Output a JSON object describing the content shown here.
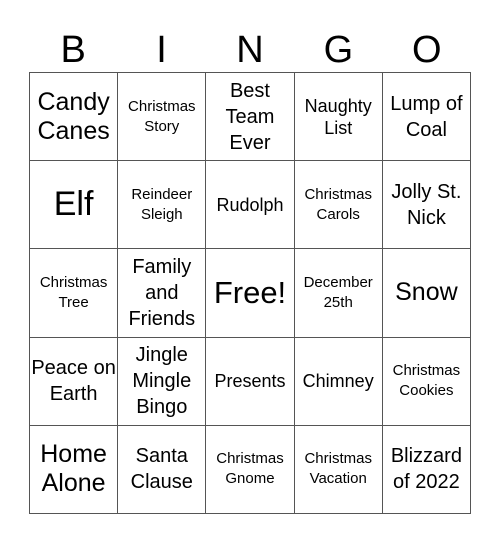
{
  "header": {
    "letters": [
      "B",
      "I",
      "N",
      "G",
      "O"
    ]
  },
  "grid": {
    "rows": [
      [
        {
          "text": "Candy Canes",
          "size": "s-l"
        },
        {
          "text": "Christmas Story",
          "size": "s-s"
        },
        {
          "text": "Best Team Ever",
          "size": "s-m"
        },
        {
          "text": "Naughty List",
          "size": "s-ms"
        },
        {
          "text": "Lump of Coal",
          "size": "s-m"
        }
      ],
      [
        {
          "text": "Elf",
          "size": "s-xl"
        },
        {
          "text": "Reindeer Sleigh",
          "size": "s-s"
        },
        {
          "text": "Rudolph",
          "size": "s-ms"
        },
        {
          "text": "Christmas Carols",
          "size": "s-s"
        },
        {
          "text": "Jolly St. Nick",
          "size": "s-m"
        }
      ],
      [
        {
          "text": "Christmas Tree",
          "size": "s-s"
        },
        {
          "text": "Family and Friends",
          "size": "s-m"
        },
        {
          "text": "Free!",
          "size": "s-free"
        },
        {
          "text": "December 25th",
          "size": "s-s"
        },
        {
          "text": "Snow",
          "size": "s-l"
        }
      ],
      [
        {
          "text": "Peace on Earth",
          "size": "s-m"
        },
        {
          "text": "Jingle Mingle Bingo",
          "size": "s-m"
        },
        {
          "text": "Presents",
          "size": "s-ms"
        },
        {
          "text": "Chimney",
          "size": "s-ms"
        },
        {
          "text": "Christmas Cookies",
          "size": "s-s"
        }
      ],
      [
        {
          "text": "Home Alone",
          "size": "s-l"
        },
        {
          "text": "Santa Clause",
          "size": "s-m"
        },
        {
          "text": "Christmas Gnome",
          "size": "s-s"
        },
        {
          "text": "Christmas Vacation",
          "size": "s-s"
        },
        {
          "text": "Blizzard of 2022",
          "size": "s-m"
        }
      ]
    ]
  }
}
